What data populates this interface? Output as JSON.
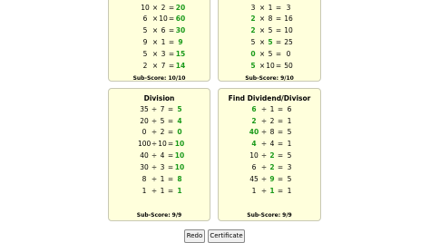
{
  "panels": {
    "top_left": {
      "rows": [
        [
          "10",
          "×",
          "2",
          "=",
          "20"
        ],
        [
          "6",
          "×",
          "10",
          "=",
          "60"
        ],
        [
          "5",
          "×",
          "6",
          "=",
          "30"
        ],
        [
          "9",
          "×",
          "1",
          "=",
          "9"
        ],
        [
          "5",
          "×",
          "3",
          "=",
          "15"
        ],
        [
          "2",
          "×",
          "7",
          "=",
          "14"
        ]
      ],
      "subscore": "Sub-Score: 10/10"
    },
    "top_right": {
      "rows": [
        [
          "3",
          "×",
          "1",
          "=",
          "3"
        ],
        [
          "2",
          "×",
          "8",
          "=",
          "16"
        ],
        [
          "2",
          "×",
          "5",
          "=",
          "10"
        ],
        [
          "5",
          "×",
          "5",
          "=",
          "25"
        ],
        [
          "0",
          "×",
          "5",
          "=",
          "0"
        ],
        [
          "5",
          "×",
          "10",
          "=",
          "50"
        ]
      ],
      "subscore": "Sub-Score: 9/10"
    },
    "division": {
      "title": "Division",
      "rows": [
        [
          "35",
          "÷",
          "7",
          "=",
          "5"
        ],
        [
          "20",
          "÷",
          "5",
          "=",
          "4"
        ],
        [
          "0",
          "÷",
          "2",
          "=",
          "0"
        ],
        [
          "100",
          "÷",
          "10",
          "=",
          "10"
        ],
        [
          "40",
          "÷",
          "4",
          "=",
          "10"
        ],
        [
          "30",
          "÷",
          "3",
          "=",
          "10"
        ],
        [
          "8",
          "÷",
          "1",
          "=",
          "8"
        ],
        [
          "1",
          "÷",
          "1",
          "=",
          "1"
        ]
      ],
      "subscore": "Sub-Score: 9/9"
    },
    "find": {
      "title": "Find Dividend/Divisor",
      "rows": [
        [
          "6",
          "÷",
          "1",
          "=",
          "6"
        ],
        [
          "2",
          "÷",
          "2",
          "=",
          "1"
        ],
        [
          "40",
          "÷",
          "8",
          "=",
          "5"
        ],
        [
          "4",
          "÷",
          "4",
          "=",
          "1"
        ],
        [
          "10",
          "÷",
          "2",
          "=",
          "5"
        ],
        [
          "6",
          "÷",
          "2",
          "=",
          "3"
        ],
        [
          "45",
          "÷",
          "9",
          "=",
          "5"
        ],
        [
          "1",
          "÷",
          "1",
          "=",
          "1"
        ]
      ],
      "subscore": "Sub-Score: 9/9"
    }
  },
  "buttons": {
    "redo": "Redo",
    "certificate": "Certificate"
  }
}
